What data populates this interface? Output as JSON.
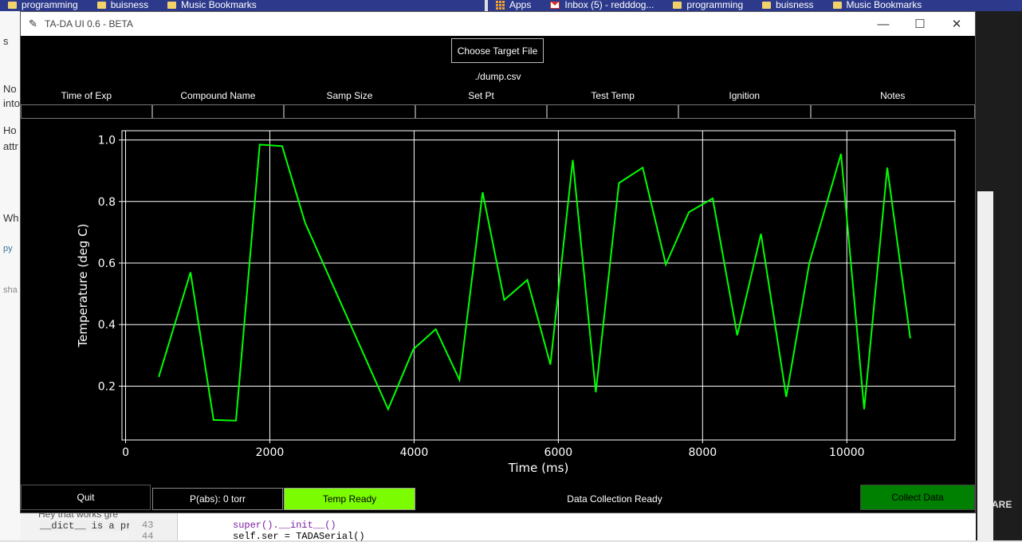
{
  "browser": {
    "bookmarks_left": [
      "programming",
      "buisness",
      "Music Bookmarks"
    ],
    "bookmarks_right_apps": "Apps",
    "bookmarks_right_inbox": "Inbox (5) - redddog...",
    "bookmarks_right": [
      "programming",
      "buisness",
      "Music Bookmarks"
    ]
  },
  "background": {
    "left_fragments": [
      "s",
      "No",
      "into",
      "Ho",
      "attr",
      "Wh",
      "py",
      "sha"
    ],
    "bottom_text_1": "Hey that works gre",
    "bottom_text_2": "__dict__ is a pro",
    "line_numbers": [
      "43",
      "44"
    ],
    "code_lines": [
      "super().__init__()",
      "self.ser = TADASerial()"
    ],
    "right_text": "ARE"
  },
  "window": {
    "title": "TA-DA UI 0.6 - BETA",
    "minimize": "—",
    "maximize": "☐",
    "close": "✕"
  },
  "file": {
    "button_label": "Choose Target File",
    "path": "./dump.csv"
  },
  "fields": {
    "labels": [
      "Time of Exp",
      "Compound Name",
      "Samp Size",
      "Set Pt",
      "Test Temp",
      "Ignition",
      "Notes"
    ]
  },
  "controls": {
    "quit_label": "Quit",
    "pressure_label": "P(abs): 0 torr",
    "temp_ready_label": "Temp Ready",
    "status_label": "Data Collection Ready",
    "collect_label": "Collect Data"
  },
  "colors": {
    "line": "#00ff00",
    "temp_ready_bg": "#7cfc00",
    "collect_bg": "#008000"
  },
  "chart_data": {
    "type": "line",
    "title": "",
    "xlabel": "Time (ms)",
    "ylabel": "Temperature (deg C)",
    "xlim": [
      -50,
      11500
    ],
    "ylim": [
      0.025,
      1.03
    ],
    "xticks": [
      0,
      2000,
      4000,
      6000,
      8000,
      10000
    ],
    "yticks": [
      0.2,
      0.4,
      0.6,
      0.8,
      1.0
    ],
    "xtick_labels": [
      "0",
      "2000",
      "4000",
      "6000",
      "8000",
      "10000"
    ],
    "ytick_labels": [
      "0.2",
      "0.4",
      "0.6",
      "0.8",
      "1.0"
    ],
    "grid": true,
    "series": [
      {
        "x": [
          460,
          900,
          1220,
          1530,
          1860,
          2170,
          2490,
          3640,
          3990,
          4300,
          4630,
          4950,
          5250,
          5570,
          5890,
          6200,
          6520,
          6840,
          7170,
          7490,
          7810,
          8140,
          8480,
          8810,
          9160,
          9480,
          9920,
          10240,
          10560,
          10880
        ],
        "y": [
          0.23,
          0.57,
          0.09,
          0.088,
          0.985,
          0.98,
          0.73,
          0.125,
          0.32,
          0.385,
          0.22,
          0.83,
          0.48,
          0.545,
          0.27,
          0.935,
          0.18,
          0.86,
          0.91,
          0.595,
          0.765,
          0.81,
          0.365,
          0.695,
          0.165,
          0.6,
          0.955,
          0.125,
          0.91,
          0.355
        ]
      }
    ]
  }
}
